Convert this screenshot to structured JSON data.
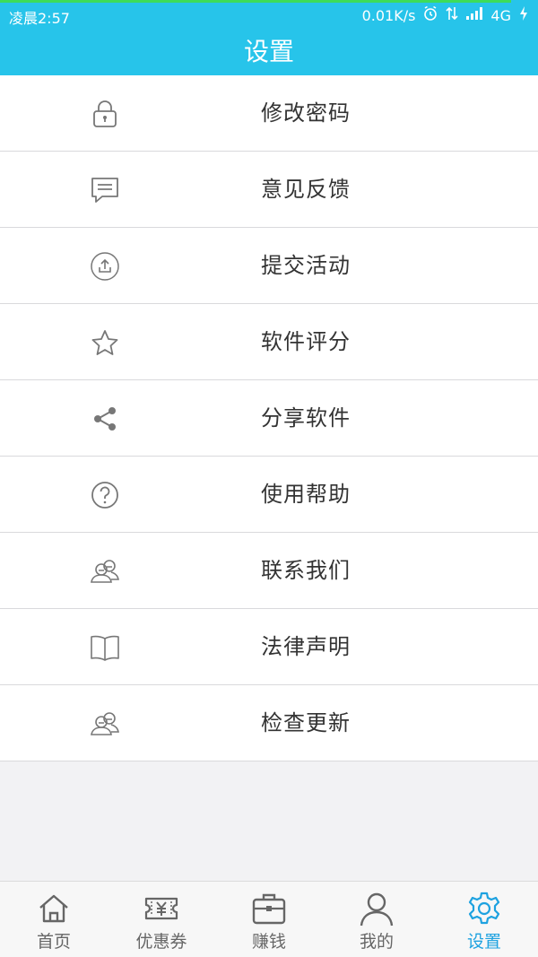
{
  "status_bar": {
    "time": "凌晨2:57",
    "net_speed": "0.01K/s",
    "network": "4G"
  },
  "header": {
    "title": "设置"
  },
  "menu": [
    {
      "label": "修改密码",
      "icon": "lock-icon"
    },
    {
      "label": "意见反馈",
      "icon": "chat-icon"
    },
    {
      "label": "提交活动",
      "icon": "upload-icon"
    },
    {
      "label": "软件评分",
      "icon": "star-icon"
    },
    {
      "label": "分享软件",
      "icon": "share-icon"
    },
    {
      "label": "使用帮助",
      "icon": "help-icon"
    },
    {
      "label": "联系我们",
      "icon": "contacts-icon"
    },
    {
      "label": "法律声明",
      "icon": "book-icon"
    },
    {
      "label": "检查更新",
      "icon": "contacts-icon"
    }
  ],
  "tabs": [
    {
      "label": "首页",
      "icon": "home-icon"
    },
    {
      "label": "优惠券",
      "icon": "coupon-icon"
    },
    {
      "label": "赚钱",
      "icon": "briefcase-icon"
    },
    {
      "label": "我的",
      "icon": "user-icon"
    },
    {
      "label": "设置",
      "icon": "settings-icon",
      "active": true
    }
  ],
  "colors": {
    "header": "#27c4ea",
    "active_tab": "#1ea2e0",
    "text": "#333333",
    "icon": "#777777"
  }
}
